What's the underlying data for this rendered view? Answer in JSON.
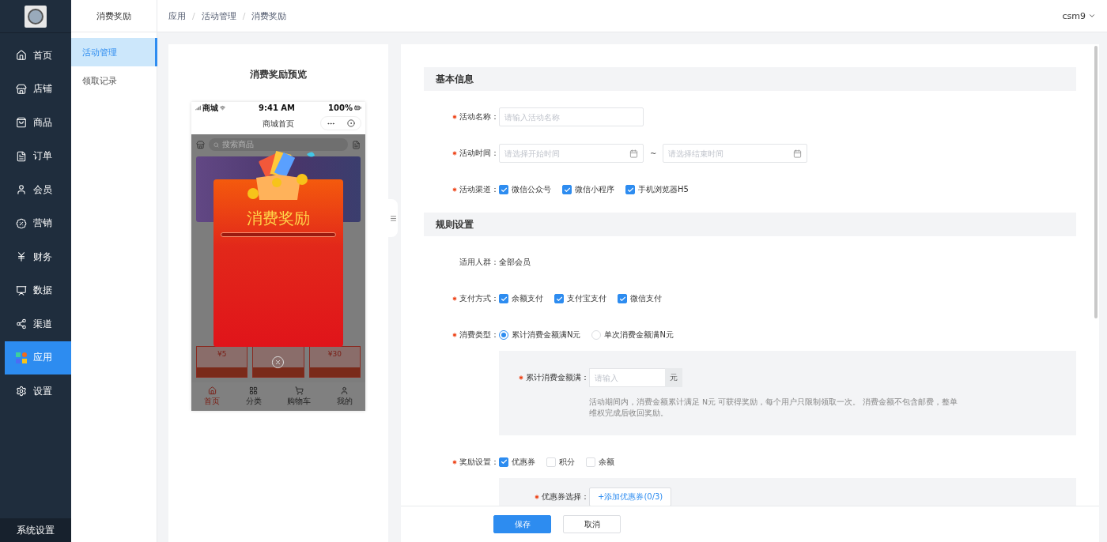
{
  "sidebar": {
    "items": [
      {
        "label": "首页",
        "selected": false
      },
      {
        "label": "店铺",
        "selected": false
      },
      {
        "label": "商品",
        "selected": false
      },
      {
        "label": "订单",
        "selected": false
      },
      {
        "label": "会员",
        "selected": false
      },
      {
        "label": "营销",
        "selected": false
      },
      {
        "label": "财务",
        "selected": false
      },
      {
        "label": "数据",
        "selected": false
      },
      {
        "label": "渠道",
        "selected": false
      },
      {
        "label": "应用",
        "selected": true
      },
      {
        "label": "设置",
        "selected": false
      }
    ],
    "footer": "系统设置"
  },
  "subnav": {
    "title": "消费奖励",
    "items": [
      {
        "label": "活动管理",
        "selected": true
      },
      {
        "label": "领取记录",
        "selected": false
      }
    ]
  },
  "breadcrumb": [
    "应用",
    "活动管理",
    "消费奖励"
  ],
  "breadcrumb_separator": "/",
  "user": "csm9",
  "preview": {
    "title": "消费奖励预览",
    "phone": {
      "carrier": "商城",
      "time": "9:41 AM",
      "battery": "100%",
      "page_title": "商城首页",
      "search_placeholder": "搜索商品",
      "popup_title": "消费奖励",
      "coupons": [
        "¥5",
        "¥30"
      ],
      "tabs": [
        {
          "label": "首页",
          "selected": true
        },
        {
          "label": "分类",
          "selected": false
        },
        {
          "label": "购物车",
          "selected": false
        },
        {
          "label": "我的",
          "selected": false
        }
      ]
    }
  },
  "form": {
    "sections": [
      {
        "title": "基本信息",
        "rows": [
          {
            "kind": "input",
            "label": "活动名称：",
            "required": true,
            "placeholder": "请输入活动名称"
          },
          {
            "kind": "daterange",
            "label": "活动时间：",
            "required": true,
            "start_placeholder": "请选择开始时间",
            "separator": "~",
            "end_placeholder": "请选择结束时间"
          },
          {
            "kind": "checkboxes",
            "label": "活动渠道：",
            "required": true,
            "options": [
              {
                "label": "微信公众号",
                "checked": true
              },
              {
                "label": "微信小程序",
                "checked": true
              },
              {
                "label": "手机浏览器H5",
                "checked": true
              }
            ]
          }
        ]
      },
      {
        "title": "规则设置",
        "rows": [
          {
            "kind": "text",
            "label": "适用人群：",
            "required": false,
            "value": "全部会员"
          },
          {
            "kind": "checkboxes",
            "label": "支付方式：",
            "required": true,
            "options": [
              {
                "label": "余额支付",
                "checked": true
              },
              {
                "label": "支付宝支付",
                "checked": true
              },
              {
                "label": "微信支付",
                "checked": true
              }
            ]
          },
          {
            "kind": "radios",
            "label": "消费类型：",
            "required": true,
            "options": [
              {
                "label": "累计消费金额满N元",
                "selected": true
              },
              {
                "label": "单次消费金额满N元",
                "selected": false
              }
            ],
            "panel": {
              "kind": "amount",
              "label": "累计消费金额满：",
              "required": true,
              "placeholder": "请输入",
              "suffix": "元",
              "hint": "活动期间内，消费金额累计满足 N元 可获得奖励，每个用户只限制领取一次。 消费金额不包含邮费，整单维权完成后收回奖励。"
            }
          },
          {
            "kind": "checkboxes",
            "label": "奖励设置：",
            "required": true,
            "options": [
              {
                "label": "优惠券",
                "checked": true
              },
              {
                "label": "积分",
                "checked": false
              },
              {
                "label": "余额",
                "checked": false
              }
            ],
            "panel": {
              "kind": "coupon",
              "label": "优惠券选择：",
              "required": true,
              "button": "+添加优惠券(0/3)"
            }
          }
        ]
      }
    ],
    "buttons": [
      {
        "label": "保存",
        "kind": "primary"
      },
      {
        "label": "取消",
        "kind": "default"
      }
    ]
  }
}
